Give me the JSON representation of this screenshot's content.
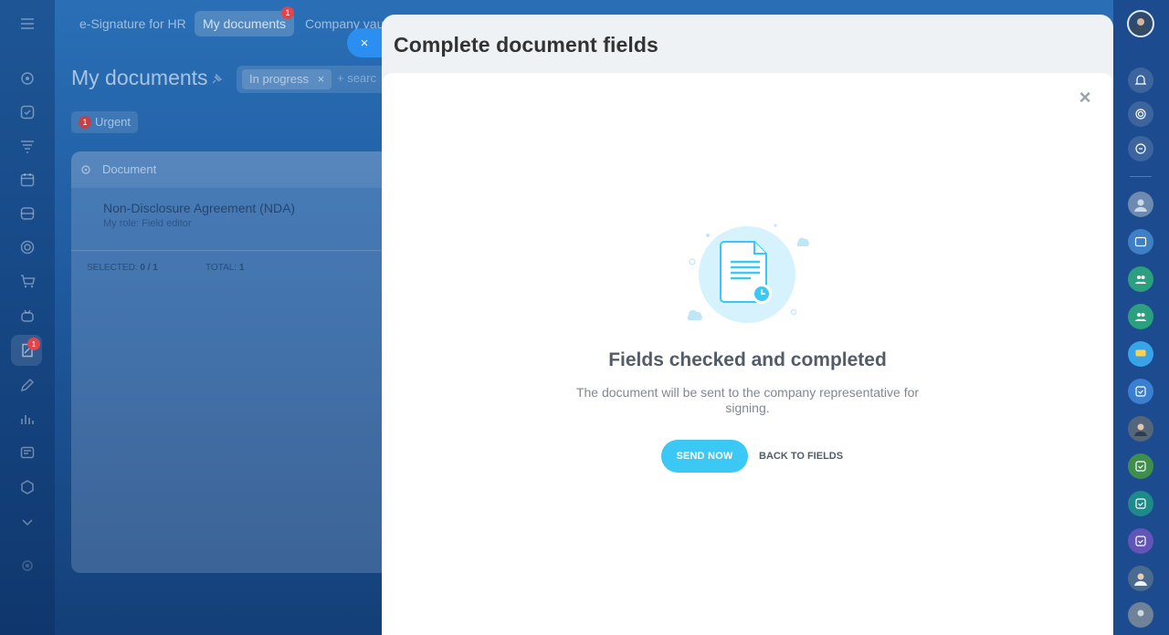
{
  "topbar": {
    "tabs": [
      {
        "label": "e-Signature for HR"
      },
      {
        "label": "My documents",
        "badge": "1"
      },
      {
        "label": "Company vau"
      }
    ]
  },
  "page": {
    "title": "My documents",
    "filter_chip": "In progress",
    "filter_chip_remove": "×",
    "search_placeholder": "+ searc",
    "urgent_count": "1",
    "urgent_label": "Urgent"
  },
  "table": {
    "header": "Document",
    "row_title": "Non-Disclosure Agreement (NDA)",
    "row_subtitle": "My role: Field editor",
    "selected_label": "SELECTED:",
    "selected_value": "0 / 1",
    "total_label": "TOTAL:",
    "total_value": "1"
  },
  "left_rail": {
    "badge": "1",
    "icons": [
      "menu-icon",
      "crm-icon",
      "tasks-icon",
      "feed-icon",
      "calendar-icon",
      "drive-icon",
      "goals-icon",
      "shop-icon",
      "robot-icon",
      "sign-icon",
      "pen-icon",
      "analytics-icon",
      "sites-icon",
      "box-icon",
      "more-icon",
      "settings-icon"
    ]
  },
  "slider": {
    "close_label": "×",
    "title": "Complete document fields",
    "body_close": "×",
    "result_title": "Fields checked and completed",
    "result_description": "The document will be sent to the company representative for signing.",
    "send_label": "SEND NOW",
    "back_label": "BACK TO FIELDS"
  },
  "colors": {
    "accent": "#3bc8f5",
    "close_tab": "#2a8ff0",
    "badge": "#e0454c"
  }
}
